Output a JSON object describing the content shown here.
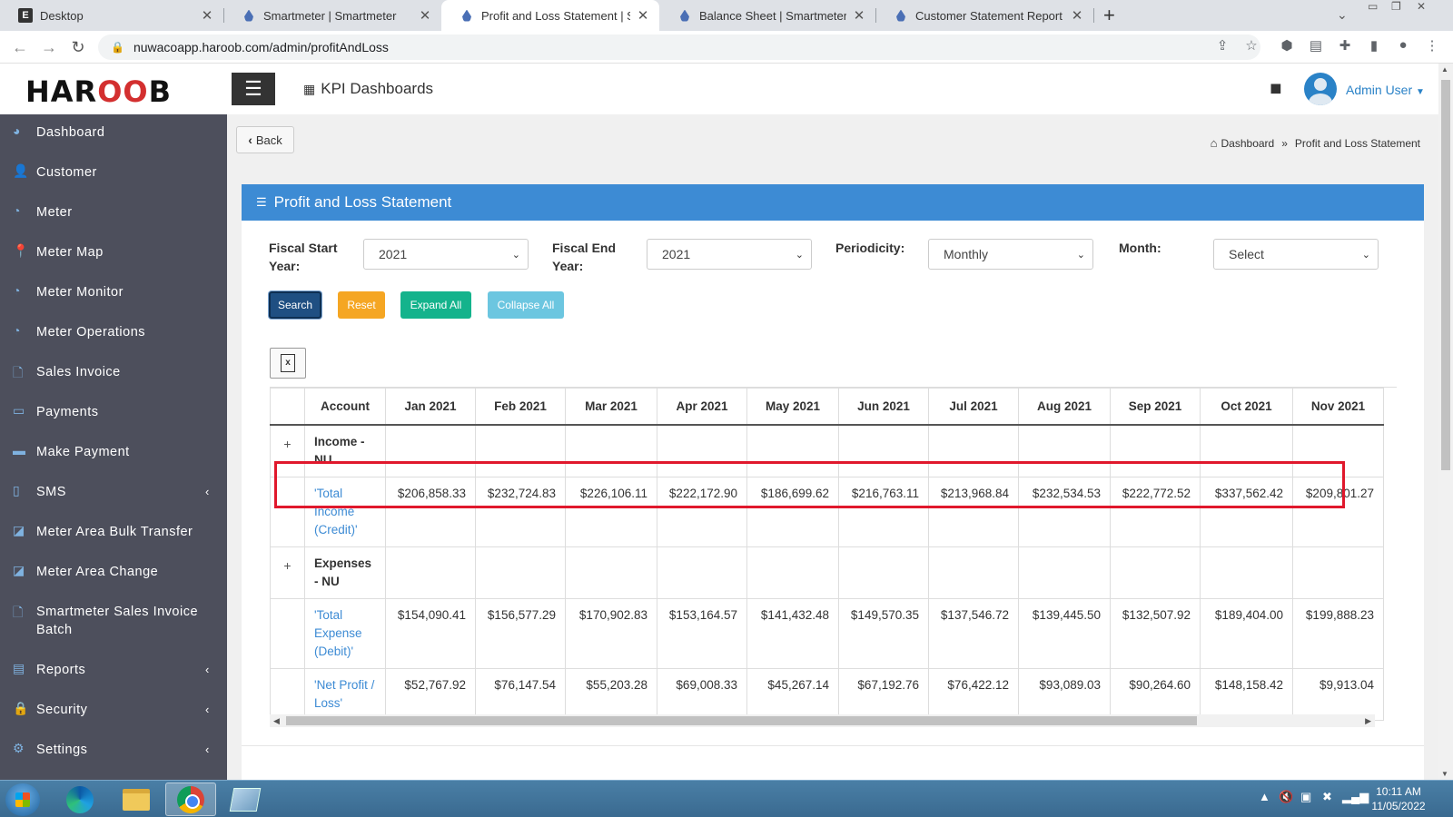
{
  "browser": {
    "tabs": [
      {
        "title": "Desktop",
        "icon": "e-logo-icon",
        "active": false
      },
      {
        "title": "Smartmeter | Smartmeter",
        "icon": "smartmeter-drop-icon",
        "active": false
      },
      {
        "title": "Profit and Loss Statement | Smart",
        "icon": "smartmeter-drop-icon",
        "active": true
      },
      {
        "title": "Balance Sheet | Smartmeter",
        "icon": "smartmeter-drop-icon",
        "active": false
      },
      {
        "title": "Customer Statement Report",
        "icon": "smartmeter-drop-icon",
        "active": false
      }
    ],
    "url": "nuwacoapp.haroob.com/admin/profitAndLoss"
  },
  "header": {
    "logo": "HAROOB",
    "section_title": "KPI Dashboards",
    "user_name": "Admin User"
  },
  "sidebar": {
    "items": [
      {
        "label": "Dashboard",
        "icon": "pie-chart-icon",
        "has_submenu": false
      },
      {
        "label": "Customer",
        "icon": "user-icon",
        "has_submenu": false
      },
      {
        "label": "Meter",
        "icon": "gauge-icon",
        "has_submenu": false
      },
      {
        "label": "Meter Map",
        "icon": "map-pin-icon",
        "has_submenu": false
      },
      {
        "label": "Meter Monitor",
        "icon": "gauge-icon",
        "has_submenu": false
      },
      {
        "label": "Meter Operations",
        "icon": "gauge-icon",
        "has_submenu": false
      },
      {
        "label": "Sales Invoice",
        "icon": "file-icon",
        "has_submenu": false
      },
      {
        "label": "Payments",
        "icon": "money-icon",
        "has_submenu": false
      },
      {
        "label": "Make Payment",
        "icon": "credit-card-icon",
        "has_submenu": false
      },
      {
        "label": "SMS",
        "icon": "mobile-icon",
        "has_submenu": true
      },
      {
        "label": "Meter Area Bulk Transfer",
        "icon": "chart-icon",
        "has_submenu": false
      },
      {
        "label": "Meter Area Change",
        "icon": "chart-icon",
        "has_submenu": false
      },
      {
        "label": "Smartmeter Sales Invoice Batch",
        "icon": "file-icon",
        "has_submenu": false
      },
      {
        "label": "Reports",
        "icon": "report-icon",
        "has_submenu": true
      },
      {
        "label": "Security",
        "icon": "lock-icon",
        "has_submenu": true
      },
      {
        "label": "Settings",
        "icon": "gear-icon",
        "has_submenu": true
      }
    ]
  },
  "page": {
    "back_label": "Back",
    "breadcrumb": {
      "home": "Dashboard",
      "separator": "»",
      "current": "Profit and Loss Statement"
    },
    "panel_title": "Profit and Loss Statement",
    "filters": {
      "fiscal_start_label": "Fiscal Start Year:",
      "fiscal_start_value": "2021",
      "fiscal_end_label": "Fiscal End Year:",
      "fiscal_end_value": "2021",
      "periodicity_label": "Periodicity:",
      "periodicity_value": "Monthly",
      "month_label": "Month:",
      "month_value": "Select"
    },
    "buttons": {
      "search": "Search",
      "reset": "Reset",
      "expand": "Expand All",
      "collapse": "Collapse All"
    },
    "export_icon": "excel-export-icon"
  },
  "table": {
    "columns": [
      "",
      "Account",
      "Jan 2021",
      "Feb 2021",
      "Mar 2021",
      "Apr 2021",
      "May 2021",
      "Jun 2021",
      "Jul 2021",
      "Aug 2021",
      "Sep 2021",
      "Oct 2021",
      "Nov 2021"
    ],
    "rows": [
      {
        "toggle": "+",
        "account": "Income - NU",
        "type": "group",
        "values": [
          "",
          "",
          "",
          "",
          "",
          "",
          "",
          "",
          "",
          "",
          ""
        ]
      },
      {
        "toggle": "",
        "account": "'Total Income (Credit)'",
        "type": "link",
        "values": [
          "$206,858.33",
          "$232,724.83",
          "$226,106.11",
          "$222,172.90",
          "$186,699.62",
          "$216,763.11",
          "$213,968.84",
          "$232,534.53",
          "$222,772.52",
          "$337,562.42",
          "$209,801.27"
        ]
      },
      {
        "toggle": "+",
        "account": "Expenses - NU",
        "type": "group",
        "values": [
          "",
          "",
          "",
          "",
          "",
          "",
          "",
          "",
          "",
          "",
          ""
        ]
      },
      {
        "toggle": "",
        "account": "'Total Expense (Debit)'",
        "type": "link",
        "values": [
          "$154,090.41",
          "$156,577.29",
          "$170,902.83",
          "$153,164.57",
          "$141,432.48",
          "$149,570.35",
          "$137,546.72",
          "$139,445.50",
          "$132,507.92",
          "$189,404.00",
          "$199,888.23"
        ]
      },
      {
        "toggle": "",
        "account": "'Net Profit / Loss'",
        "type": "link",
        "highlighted": true,
        "values": [
          "$52,767.92",
          "$76,147.54",
          "$55,203.28",
          "$69,008.33",
          "$45,267.14",
          "$67,192.76",
          "$76,422.12",
          "$93,089.03",
          "$90,264.60",
          "$148,158.42",
          "$9,913.04"
        ]
      }
    ]
  },
  "taskbar": {
    "time": "10:11 AM",
    "date": "11/05/2022"
  },
  "colors": {
    "panel_header": "#3d8bd4",
    "sidebar_bg": "#4d4f5c",
    "highlight_border": "#e0182c",
    "search_btn": "#1f4f82",
    "reset_btn": "#f5a623",
    "expand_btn": "#14b38c",
    "collapse_btn": "#6cc6e0"
  }
}
